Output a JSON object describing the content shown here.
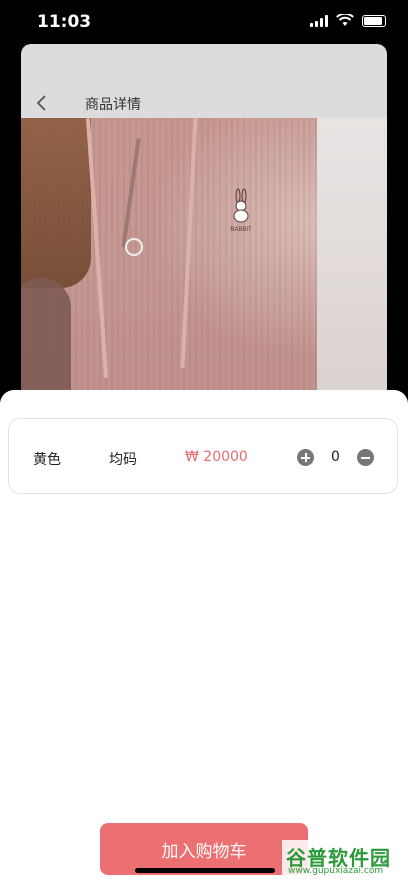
{
  "status": {
    "time": "11:03"
  },
  "nav": {
    "title": "商品详情"
  },
  "sku": {
    "color": "黄色",
    "size": "均码",
    "price": "₩ 20000",
    "quantity": "0"
  },
  "actions": {
    "add_to_cart": "加入购物车"
  },
  "logo": {
    "text": "BABBIT"
  },
  "watermark": {
    "title": "谷普软件园",
    "url": "www.gupuxiazai.com"
  },
  "colors": {
    "accent": "#ec6f72",
    "price": "#e86c70"
  }
}
